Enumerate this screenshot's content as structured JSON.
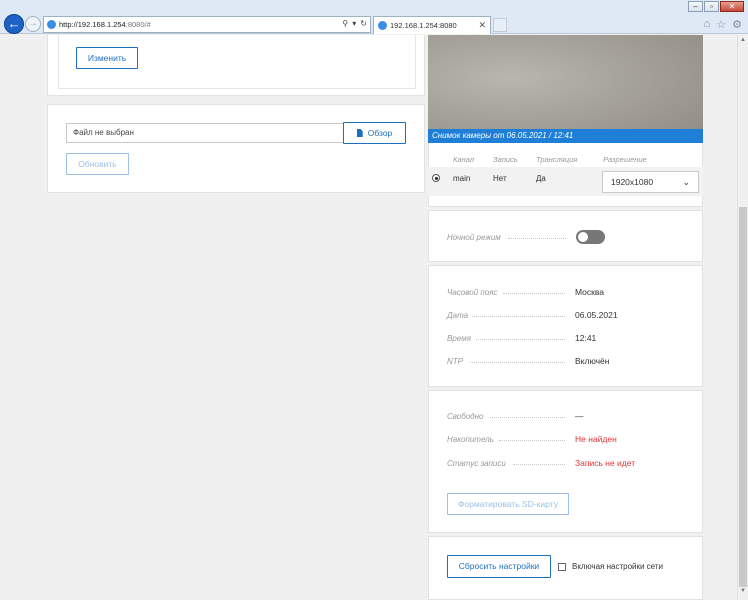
{
  "browser": {
    "url_host": "http://192.168.1.254",
    "url_rest": ":8080/#",
    "tab_title": "192.168.1.254:8080"
  },
  "left": {
    "change_button": "Изменить",
    "file_placeholder": "Файл не выбран",
    "browse_button": "Обзор",
    "update_button": "Обновить"
  },
  "camera": {
    "caption": "Снимок камеры от 06.05.2021 / 12:41",
    "headers": [
      "Канал",
      "Запись",
      "Трансляция",
      "Разрешение"
    ],
    "row": {
      "channel": "main",
      "record": "Нет",
      "stream": "Да",
      "resolution": "1920x1080"
    }
  },
  "night": {
    "label": "Ночной режим"
  },
  "time": {
    "timezone_label": "Часовой пояс",
    "timezone": "Москва",
    "date_label": "Дата",
    "date": "06.05.2021",
    "time_label": "Время",
    "time": "12:41",
    "ntp_label": "NTP",
    "ntp": "Включён"
  },
  "storage": {
    "free_label": "Свободно",
    "free": "—",
    "drive_label": "Накопитель",
    "drive": "Не найден",
    "status_label": "Статус записи",
    "status": "Запись не идет",
    "format_button": "Форматировать SD-карту"
  },
  "reset": {
    "button": "Сбросить настройки",
    "include_network": "Включая настройки сети"
  },
  "colors": {
    "accent": "#1f6fbf",
    "error": "#e23434",
    "caption_bg": "#1f7fd6"
  }
}
